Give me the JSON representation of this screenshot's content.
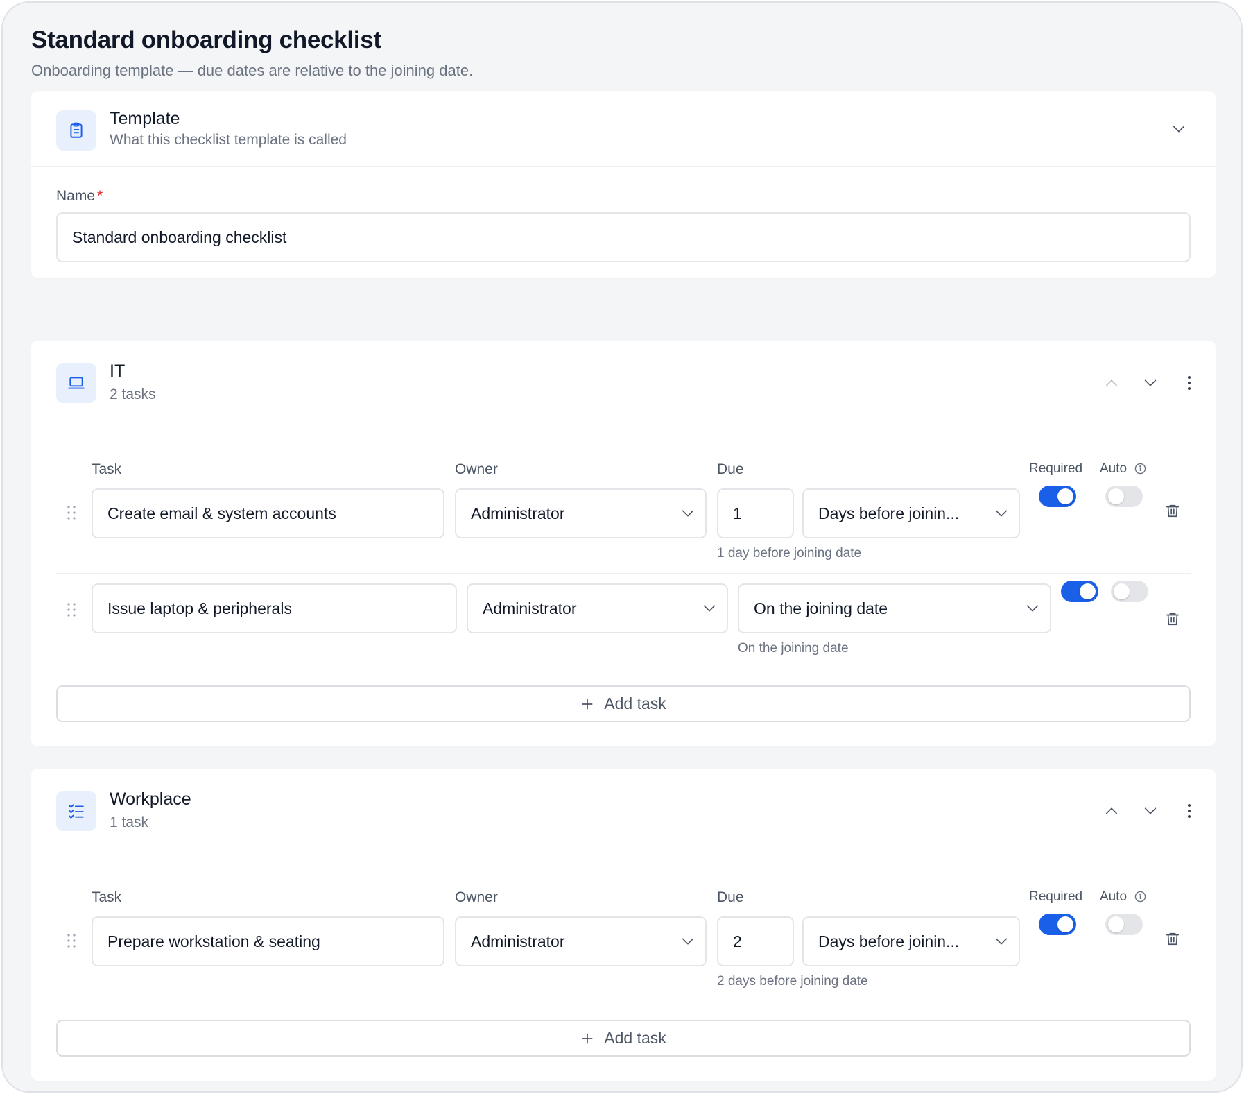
{
  "page": {
    "title": "Standard onboarding checklist",
    "subtitle": "Onboarding template — due dates are relative to the joining date."
  },
  "template_card": {
    "title": "Template",
    "subtitle": "What this checklist template is called",
    "icon": "clipboard-icon",
    "name_label": "Name",
    "required_marker": "*",
    "name_value": "Standard onboarding checklist"
  },
  "sections": [
    {
      "title": "IT",
      "count_label": "2 tasks",
      "icon": "laptop-icon",
      "columns": {
        "task": "Task",
        "owner": "Owner",
        "due": "Due",
        "required": "Required",
        "auto": "Auto"
      },
      "tasks": [
        {
          "task": "Create email & system accounts",
          "owner": "Administrator",
          "due_number": "1",
          "due_relation": "Days before joinin...",
          "due_hint": "1 day before joining date",
          "required": true,
          "auto": false
        },
        {
          "task": "Issue laptop & peripherals",
          "owner": "Administrator",
          "due_relation": "On the joining date",
          "due_hint": "On the joining date",
          "required": true,
          "auto": false
        }
      ],
      "add_label": "Add task"
    },
    {
      "title": "Workplace",
      "count_label": "1 task",
      "icon": "checklist-icon",
      "columns": {
        "task": "Task",
        "owner": "Owner",
        "due": "Due",
        "required": "Required",
        "auto": "Auto"
      },
      "tasks": [
        {
          "task": "Prepare workstation & seating",
          "owner": "Administrator",
          "due_number": "2",
          "due_relation": "Days before joinin...",
          "due_hint": "2 days before joining date",
          "required": true,
          "auto": false
        }
      ],
      "add_label": "Add task"
    }
  ],
  "colors": {
    "accent": "#1a5fe8",
    "required_star": "#dc2626",
    "page_bg": "#f4f5f7"
  }
}
